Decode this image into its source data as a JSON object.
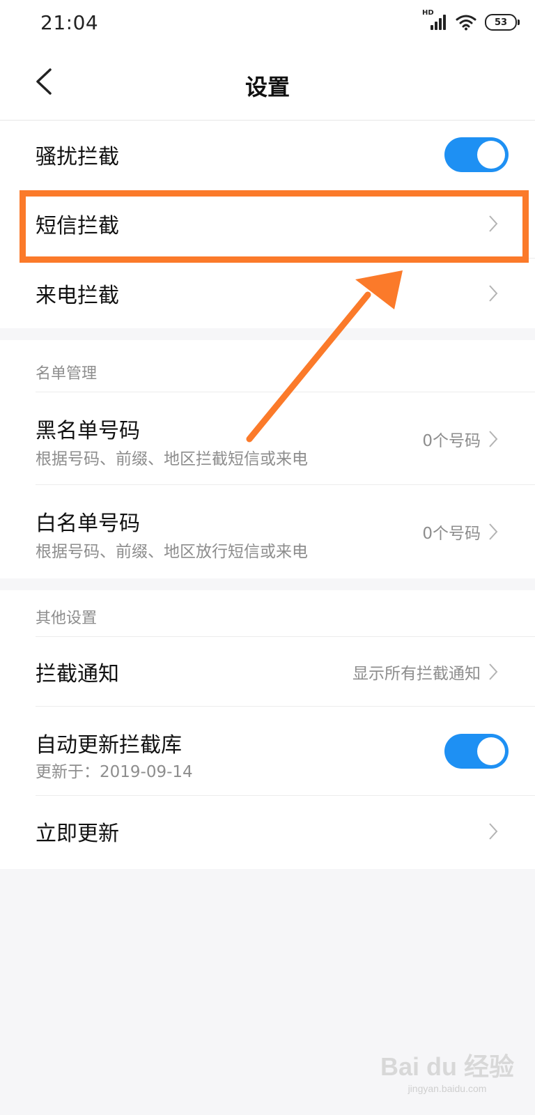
{
  "status_bar": {
    "time": "21:04",
    "network_label": "HD",
    "battery": "53"
  },
  "header": {
    "title": "设置"
  },
  "group1": {
    "rows": [
      {
        "label": "骚扰拦截",
        "toggle_on": true
      },
      {
        "label": "短信拦截"
      },
      {
        "label": "来电拦截"
      }
    ]
  },
  "list_management": {
    "section_title": "名单管理",
    "rows": [
      {
        "label": "黑名单号码",
        "sub": "根据号码、前缀、地区拦截短信或来电",
        "value": "0个号码"
      },
      {
        "label": "白名单号码",
        "sub": "根据号码、前缀、地区放行短信或来电",
        "value": "0个号码"
      }
    ]
  },
  "other_settings": {
    "section_title": "其他设置",
    "rows": [
      {
        "label": "拦截通知",
        "value": "显示所有拦截通知"
      },
      {
        "label": "自动更新拦截库",
        "sub": "更新于：2019-09-14",
        "toggle_on": true
      },
      {
        "label": "立即更新"
      }
    ]
  },
  "annotation": {
    "highlight_color": "#fb7a2a",
    "highlighted_item": "短信拦截"
  },
  "watermark": {
    "main": "Bai du 经验",
    "url": "jingyan.baidu.com"
  },
  "colors": {
    "toggle_on": "#1e90f3",
    "background": "#f6f6f8"
  }
}
